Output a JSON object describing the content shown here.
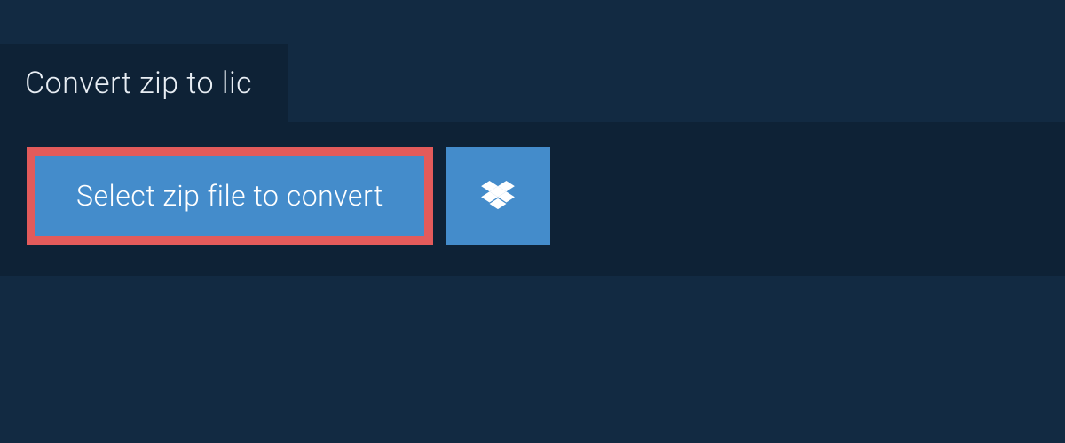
{
  "tab": {
    "title": "Convert zip to lic"
  },
  "actions": {
    "select_file_label": "Select zip file to convert"
  },
  "colors": {
    "background": "#122a42",
    "panel": "#0e2236",
    "button": "#448ccb",
    "highlight_border": "#e35b5b",
    "text_light": "#e8eef4",
    "text_white": "#ffffff"
  },
  "icons": {
    "dropbox": "dropbox-icon"
  }
}
